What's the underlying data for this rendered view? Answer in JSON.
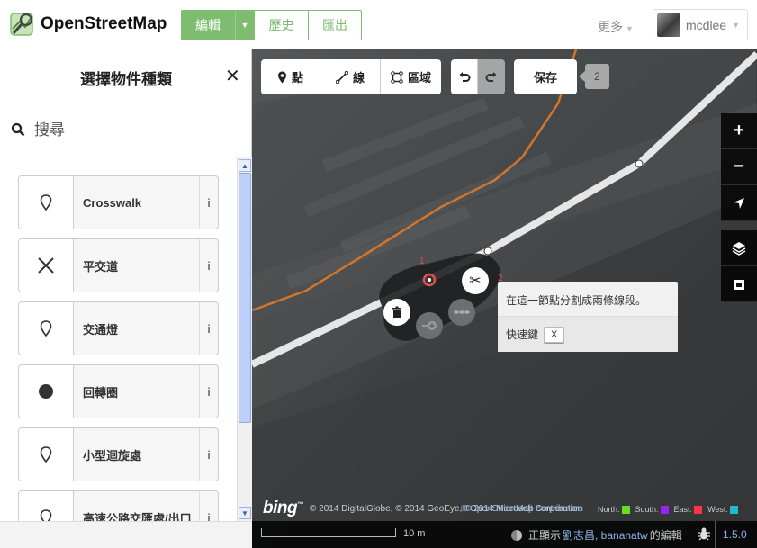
{
  "app": {
    "title": "OpenStreetMap"
  },
  "header": {
    "modes": {
      "edit": "編輯",
      "history": "歷史",
      "export": "匯出"
    },
    "more": "更多",
    "user": "mcdlee"
  },
  "sidebar": {
    "title": "選擇物件種類",
    "search_placeholder": "搜尋",
    "presets": [
      {
        "label": "Crosswalk",
        "icon": "pin-icon"
      },
      {
        "label": "平交道",
        "icon": "cross-icon"
      },
      {
        "label": "交通燈",
        "icon": "pin-icon"
      },
      {
        "label": "回轉圈",
        "icon": "dot-icon"
      },
      {
        "label": "小型迴旋處",
        "icon": "pin-icon"
      },
      {
        "label": "高速公路交匯處/出口",
        "icon": "pin-icon"
      }
    ],
    "info_label": "i"
  },
  "toolbar": {
    "point": "點",
    "line": "線",
    "area": "區域",
    "save": "保存",
    "save_count": "2"
  },
  "tooltip": {
    "message": "在這一節點分割成兩條線段。",
    "shortcut_label": "快速鍵",
    "shortcut_key": "X"
  },
  "attribution": {
    "bing": "bing",
    "copyright": "© 2014 DigitalGlobe, © 2014 GeoEye, © 2014 Microsoft Corporation",
    "osm_link": "© OpenStreetMap contributors",
    "legend": [
      {
        "label": "North:",
        "color": "#66dd22"
      },
      {
        "label": "South:",
        "color": "#9922ee"
      },
      {
        "label": "East:",
        "color": "#ff3344"
      },
      {
        "label": "West:",
        "color": "#22bbcc"
      }
    ]
  },
  "footer": {
    "scale": "10 m",
    "viewing_prefix": "正顯示",
    "users": "劉志昌, bananatw",
    "viewing_suffix": "的編輯",
    "version": "1.5.0"
  },
  "colors": {
    "accent": "#7ebc6f",
    "link": "#8ab4ee",
    "path": "#e07a2a"
  }
}
